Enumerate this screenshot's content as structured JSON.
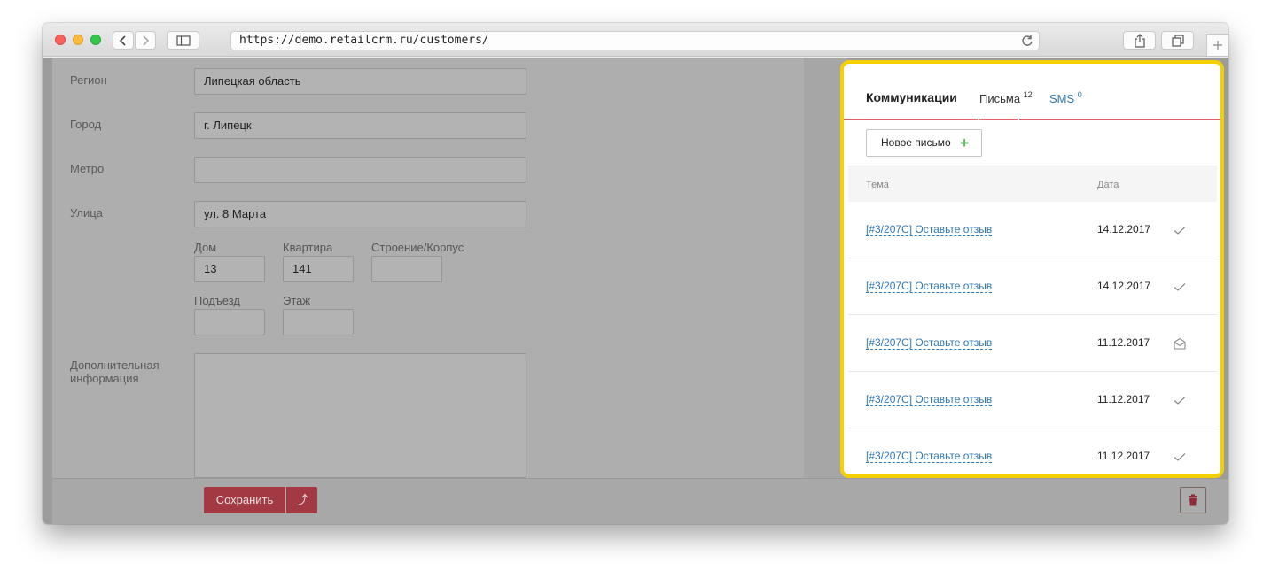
{
  "browser": {
    "url": "https://demo.retailcrm.ru/customers/"
  },
  "form": {
    "region_label": "Регион",
    "region_value": "Липецкая область",
    "city_label": "Город",
    "city_value": "г. Липецк",
    "metro_label": "Метро",
    "metro_value": "",
    "street_label": "Улица",
    "street_value": "ул. 8 Марта",
    "house_label": "Дом",
    "house_value": "13",
    "apartment_label": "Квартира",
    "apartment_value": "141",
    "building_label": "Строение/Корпус",
    "building_value": "",
    "entrance_label": "Подъезд",
    "entrance_value": "",
    "floor_label": "Этаж",
    "floor_value": "",
    "extra_label": "Дополнительная информация",
    "extra_value": ""
  },
  "savebar": {
    "save_label": "Сохранить",
    "arrow_glyph": "⤴"
  },
  "comm": {
    "tab_comm": "Коммуникации",
    "tab_mail": "Письма",
    "tab_mail_count": "12",
    "tab_sms": "SMS",
    "tab_sms_count": "0",
    "new_mail_label": "Новое письмо",
    "plus_glyph": "+",
    "col_subject": "Тема",
    "col_date": "Дата",
    "rows": [
      {
        "subject": "[#3/207C] Оставьте отзыв",
        "date": "14.12.2017",
        "status": "check-icon"
      },
      {
        "subject": "[#3/207C] Оставьте отзыв",
        "date": "14.12.2017",
        "status": "check-icon"
      },
      {
        "subject": "[#3/207C] Оставьте отзыв",
        "date": "11.12.2017",
        "status": "envelope-open-icon"
      },
      {
        "subject": "[#3/207C] Оставьте отзыв",
        "date": "11.12.2017",
        "status": "check-icon"
      },
      {
        "subject": "[#3/207C] Оставьте отзыв",
        "date": "11.12.2017",
        "status": "check-icon"
      }
    ]
  },
  "colors": {
    "highlight": "#f5d000",
    "accent_red": "#e3656c",
    "link_blue": "#2f79b6",
    "plus_green": "#5db85c"
  }
}
